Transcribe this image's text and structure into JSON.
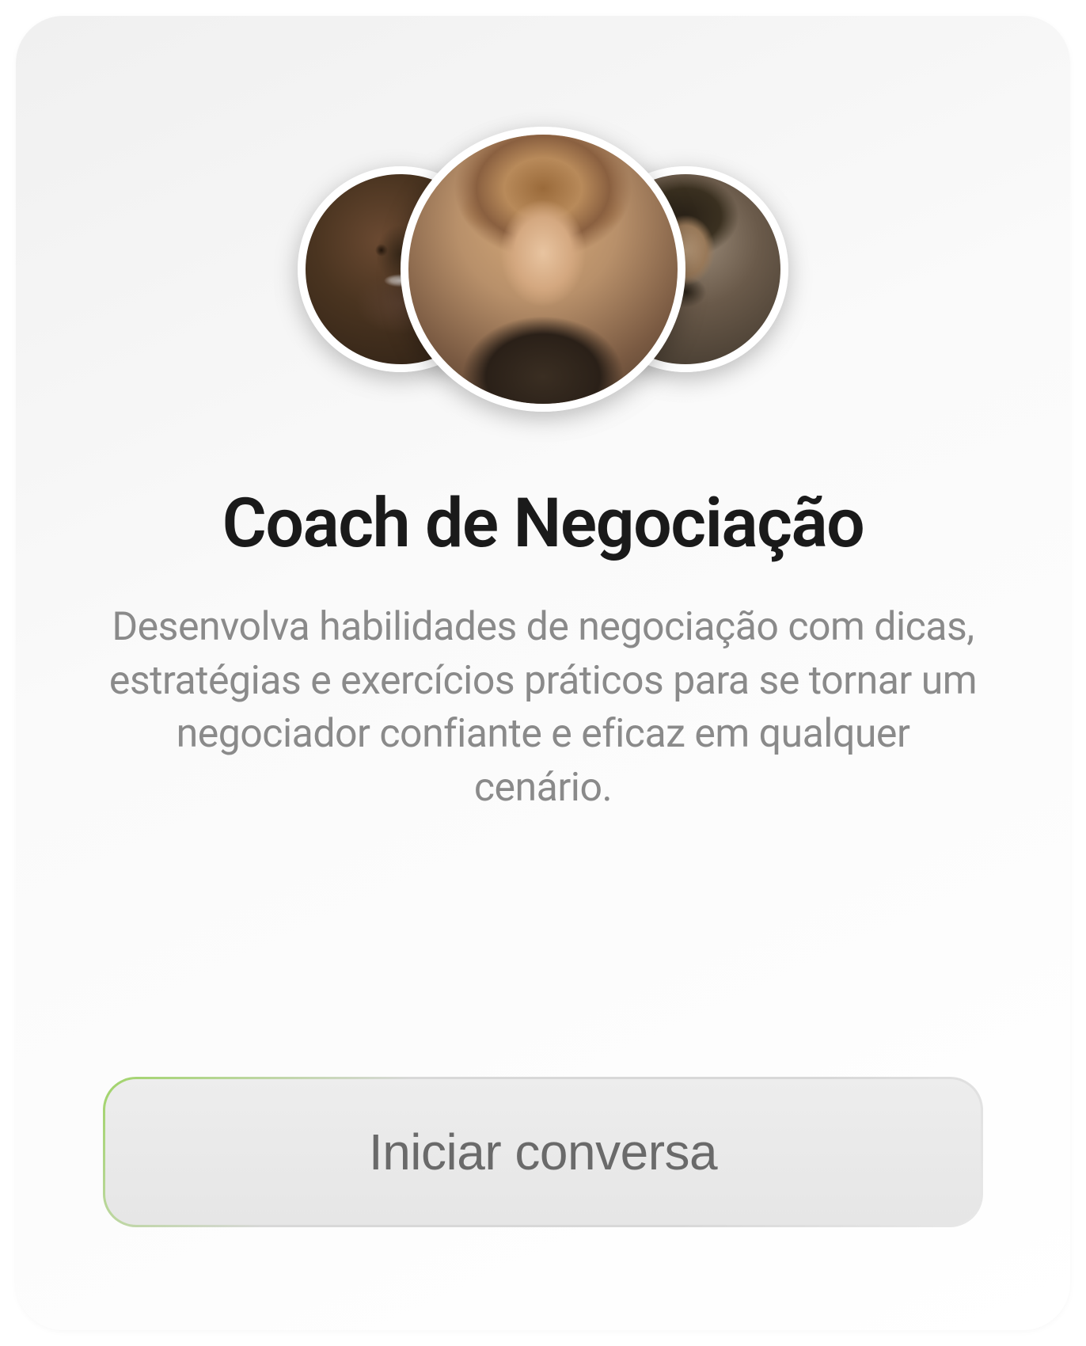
{
  "card": {
    "title": "Coach de Negociação",
    "description": "Desenvolva habilidades de negociação com dicas, estratégias e exercícios práticos para se tornar um negociador confiante e eficaz em qualquer cenário.",
    "cta_label": "Iniciar conversa",
    "avatars": {
      "left": "person-avatar-1",
      "center": "person-avatar-2",
      "right": "person-avatar-3"
    }
  }
}
